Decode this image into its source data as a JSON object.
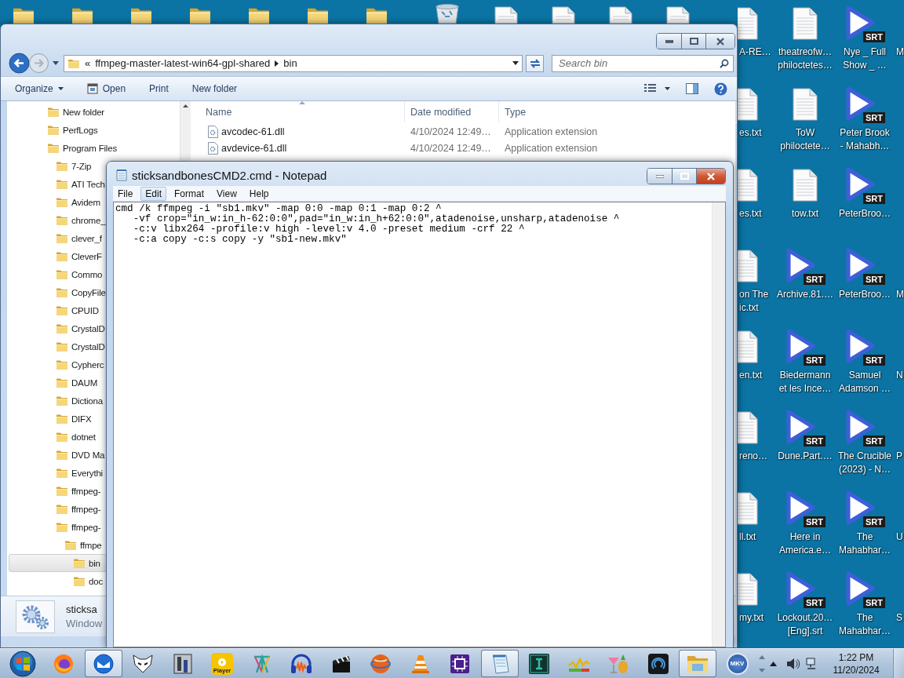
{
  "desktop": {
    "top_icons": [
      {
        "kind": "folder"
      },
      {
        "kind": "folder"
      },
      {
        "kind": "folder"
      },
      {
        "kind": "folder"
      },
      {
        "kind": "folder"
      },
      {
        "kind": "folder"
      },
      {
        "kind": "folder"
      },
      {
        "kind": "recycle"
      },
      {
        "kind": "document"
      },
      {
        "kind": "document"
      },
      {
        "kind": "document"
      },
      {
        "kind": "document"
      }
    ],
    "columns": [
      {
        "kind": "edge_left",
        "icons": [
          {
            "kind": "txt",
            "label_lines": [
              "A-RE…"
            ]
          },
          {
            "kind": "txt",
            "label_lines": [
              "es.txt"
            ]
          },
          {
            "kind": "txt",
            "label_lines": [
              "es.txt"
            ]
          },
          {
            "kind": "txt",
            "label_lines": [
              "on The",
              "ic.txt"
            ]
          },
          {
            "kind": "txt",
            "label_lines": [
              "en.txt"
            ]
          },
          {
            "kind": "txt",
            "label_lines": [
              "reno…"
            ]
          },
          {
            "kind": "txt",
            "label_lines": [
              "ll.txt"
            ]
          },
          {
            "kind": "txt",
            "label_lines": [
              "my.txt"
            ]
          }
        ]
      },
      {
        "kind": "full",
        "icons": [
          {
            "kind": "txt",
            "label_lines": [
              "theatreofw…",
              "philoctetes…"
            ]
          },
          {
            "kind": "txt",
            "label_lines": [
              "ToW",
              "philoctete…"
            ]
          },
          {
            "kind": "txt",
            "label_lines": [
              "tow.txt"
            ]
          },
          {
            "kind": "srt",
            "badge": "SRT",
            "label_lines": [
              "Archive.81.…"
            ]
          },
          {
            "kind": "srt",
            "badge": "SRT",
            "label_lines": [
              "Biedermann",
              "et les Ince…"
            ]
          },
          {
            "kind": "srt",
            "badge": "SRT",
            "label_lines": [
              "Dune.Part.…"
            ]
          },
          {
            "kind": "srt",
            "badge": "SRT",
            "label_lines": [
              "Here in",
              "America.e…"
            ]
          },
          {
            "kind": "srt",
            "badge": "SRT",
            "label_lines": [
              "Lockout.20…",
              "[Eng].srt"
            ]
          }
        ]
      },
      {
        "kind": "full",
        "icons": [
          {
            "kind": "srt",
            "badge": "SRT",
            "label_lines": [
              "Nye _ Full",
              "Show _ …"
            ]
          },
          {
            "kind": "srt",
            "badge": "SRT",
            "label_lines": [
              "Peter Brook",
              "- Mahabh…"
            ]
          },
          {
            "kind": "srt",
            "badge": "SRT",
            "label_lines": [
              "PeterBroo…"
            ]
          },
          {
            "kind": "srt",
            "badge": "SRT",
            "label_lines": [
              "PeterBroo…"
            ]
          },
          {
            "kind": "srt",
            "badge": "SRT",
            "label_lines": [
              "Samuel",
              "Adamson …"
            ]
          },
          {
            "kind": "srt",
            "badge": "SRT",
            "label_lines": [
              "The Crucible",
              "(2023) - N…"
            ]
          },
          {
            "kind": "srt",
            "badge": "SRT",
            "label_lines": [
              "The",
              "Mahabhar…"
            ]
          },
          {
            "kind": "srt",
            "badge": "SRT",
            "label_lines": [
              "The",
              "Mahabhar…"
            ]
          }
        ]
      },
      {
        "kind": "edge_right",
        "icons": [
          {
            "kind": "offscreen",
            "label_lines": [
              "M"
            ]
          },
          {
            "kind": "offscreen"
          },
          {
            "kind": "offscreen"
          },
          {
            "kind": "offscreen",
            "label_lines": [
              "M"
            ]
          },
          {
            "kind": "offscreen",
            "label_lines": [
              "N"
            ]
          },
          {
            "kind": "offscreen",
            "label_lines": [
              "P"
            ]
          },
          {
            "kind": "offscreen",
            "label_lines": [
              "U"
            ]
          },
          {
            "kind": "offscreen",
            "label_lines": [
              "S"
            ]
          }
        ]
      }
    ]
  },
  "explorer": {
    "address": {
      "overflow_mark": "«",
      "segments": [
        "ffmpeg-master-latest-win64-gpl-shared",
        "bin"
      ]
    },
    "search": {
      "placeholder": "Search bin"
    },
    "toolbar": [
      {
        "kind": "menu",
        "label": "Organize"
      },
      {
        "kind": "open",
        "label": "Open"
      },
      {
        "kind": "plain",
        "label": "Print"
      },
      {
        "kind": "plain",
        "label": "New folder"
      }
    ],
    "nav_tree": [
      {
        "label": "New folder",
        "selected": false
      },
      {
        "label": "PerfLogs",
        "selected": false
      },
      {
        "label": "Program Files",
        "selected": false,
        "children": [
          {
            "label": "7-Zip",
            "selected": false
          },
          {
            "label": "ATI Tech",
            "selected": false
          },
          {
            "label": "Avidem",
            "selected": false
          },
          {
            "label": "chrome_",
            "selected": false
          },
          {
            "label": "clever_f",
            "selected": false
          },
          {
            "label": "CleverF",
            "selected": false
          },
          {
            "label": "Commo",
            "selected": false
          },
          {
            "label": "CopyFile",
            "selected": false
          },
          {
            "label": "CPUID",
            "selected": false
          },
          {
            "label": "CrystalD",
            "selected": false
          },
          {
            "label": "CrystalD",
            "selected": false
          },
          {
            "label": "Cypherc",
            "selected": false
          },
          {
            "label": "DAUM",
            "selected": false
          },
          {
            "label": "Dictiona",
            "selected": false
          },
          {
            "label": "DIFX",
            "selected": false
          },
          {
            "label": "dotnet",
            "selected": false
          },
          {
            "label": "DVD Ma",
            "selected": false
          },
          {
            "label": "Everythi",
            "selected": false
          },
          {
            "label": "ffmpeg-",
            "selected": false
          },
          {
            "label": "ffmpeg-",
            "selected": false
          },
          {
            "label": "ffmpeg-",
            "selected": false,
            "children": [
              {
                "label": "ffmpe",
                "selected": false,
                "children": [
                  {
                    "label": "bin",
                    "selected": true
                  },
                  {
                    "label": "doc",
                    "selected": false
                  }
                ]
              }
            ]
          }
        ]
      }
    ],
    "columns": [
      {
        "label": "Name",
        "sorted": true
      },
      {
        "label": "Date modified",
        "sorted": false
      },
      {
        "label": "Type",
        "sorted": false
      }
    ],
    "files": [
      {
        "name": "avcodec-61.dll",
        "date": "4/10/2024 12:49…",
        "type": "Application extension"
      },
      {
        "name": "avdevice-61.dll",
        "date": "4/10/2024 12:49…",
        "type": "Application extension"
      }
    ],
    "details": {
      "name": "sticksa",
      "type": "Window"
    }
  },
  "notepad": {
    "title": "sticksandbonesCMD2.cmd - Notepad",
    "menu": [
      {
        "label": "File",
        "selected": false
      },
      {
        "label": "Edit",
        "selected": true
      },
      {
        "label": "Format",
        "selected": false
      },
      {
        "label": "View",
        "selected": false
      },
      {
        "label": "Help",
        "selected": false
      }
    ],
    "text": "cmd /k ffmpeg -i \"sb1.mkv\" -map 0:0 -map 0:1 -map 0:2 ^\n   -vf crop=\"in_w:in_h-62:0:0\",pad=\"in_w:in_h+62:0:0\",atadenoise,unsharp,atadenoise ^\n   -c:v libx264 -profile:v high -level:v 4.0 -preset medium -crf 22 ^\n   -c:a copy -c:s copy -y \"sb1-new.mkv\""
  },
  "taskbar": {
    "items": [
      {
        "kind": "firefox",
        "active": false
      },
      {
        "kind": "thunderbird",
        "active": true
      },
      {
        "kind": "mask",
        "active": false
      },
      {
        "kind": "tj",
        "active": false
      },
      {
        "kind": "player",
        "active": false,
        "text": "Player"
      },
      {
        "kind": "tools",
        "active": false
      },
      {
        "kind": "audio",
        "active": false
      },
      {
        "kind": "clapper",
        "active": false
      },
      {
        "kind": "globe",
        "active": false
      },
      {
        "kind": "cone",
        "active": false
      },
      {
        "kind": "chip",
        "active": false
      },
      {
        "kind": "notepad",
        "active": true
      },
      {
        "kind": "ibeam",
        "active": false
      },
      {
        "kind": "wave",
        "active": false
      },
      {
        "kind": "cocktail",
        "active": false
      },
      {
        "kind": "swirl",
        "active": false
      },
      {
        "kind": "explorer",
        "active": true
      },
      {
        "kind": "mkv",
        "active": false,
        "text": "MKV"
      }
    ],
    "clock": {
      "time": "1:22 PM",
      "date": "11/20/2024"
    }
  }
}
